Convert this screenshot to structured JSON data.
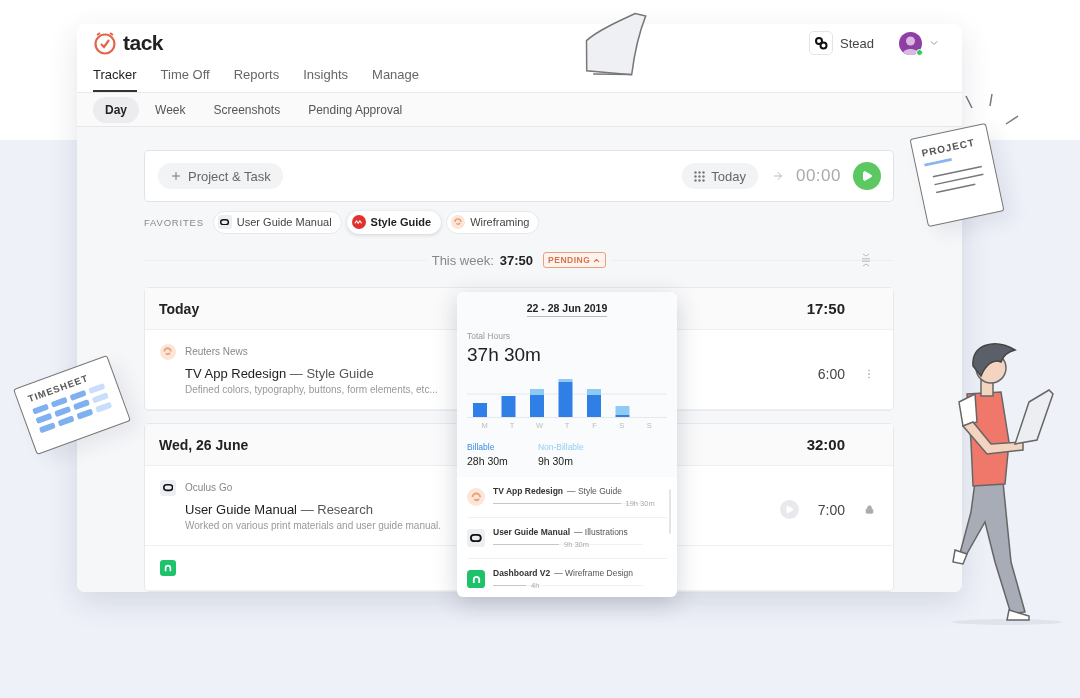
{
  "app": {
    "logo": "tack",
    "workspace": "Stead",
    "online": true
  },
  "tabs": [
    {
      "label": "Tracker",
      "selected": true
    },
    {
      "label": "Time Off",
      "selected": false
    },
    {
      "label": "Reports",
      "selected": false
    },
    {
      "label": "Insights",
      "selected": false
    },
    {
      "label": "Manage",
      "selected": false
    }
  ],
  "subtabs": [
    {
      "label": "Day",
      "selected": true
    },
    {
      "label": "Week",
      "selected": false
    },
    {
      "label": "Screenshots",
      "selected": false
    },
    {
      "label": "Pending Approval",
      "selected": false
    }
  ],
  "timer": {
    "project_button": "Project & Task",
    "date_button": "Today",
    "time": "00:00"
  },
  "favorites": {
    "label": "FAVORITES",
    "items": [
      {
        "label": "User Guide Manual",
        "kind": "headset",
        "selected": false
      },
      {
        "label": "Style Guide",
        "kind": "brand",
        "selected": true
      },
      {
        "label": "Wireframing",
        "kind": "swirl",
        "selected": false
      }
    ]
  },
  "week": {
    "label": "This week:",
    "total": "37:50",
    "status": "PENDING"
  },
  "days": [
    {
      "title": "Today",
      "total": "17:50",
      "entries": [
        {
          "kind": "swirl",
          "client": "Reuters News",
          "project": "TV App Redesign",
          "task": "— Style Guide",
          "description": "Defined colors, typography, buttons, form elements, etc...",
          "duration": "6:00",
          "locked": false
        }
      ]
    },
    {
      "title": "Wed, 26 June",
      "total": "32:00",
      "entries": [
        {
          "kind": "headset",
          "client": "Oculus Go",
          "project": "User Guide Manual",
          "task": "— Research",
          "description": "Worked on various print materials and user guide manual.",
          "duration": "7:00",
          "locked": true
        },
        {
          "kind": "dashboard"
        }
      ]
    }
  ],
  "popover": {
    "range": "22 - 28 Jun 2019",
    "total_label": "Total Hours",
    "total": "37h 30m",
    "days": [
      "M",
      "T",
      "W",
      "T",
      "F",
      "S",
      "S"
    ],
    "billable": {
      "label": "Billable",
      "value": "28h 30m"
    },
    "non_billable": {
      "label": "Non-Billable",
      "value": "9h 30m"
    },
    "projects": [
      {
        "kind": "swirl",
        "name": "TV App Redesign",
        "task": "— Style Guide",
        "hours": "19h 30m",
        "level": 0.85
      },
      {
        "kind": "headset",
        "name": "User Guide Manual",
        "task": "— Illustrations",
        "hours": "9h 30m",
        "level": 0.44
      },
      {
        "kind": "dashboard",
        "name": "Dashboard V2",
        "task": "— Wireframe Design",
        "hours": "4h",
        "level": 0.22
      }
    ]
  },
  "illustrations": {
    "project_sheet": "PROJECT",
    "timesheet": "TIMESHEET"
  }
}
